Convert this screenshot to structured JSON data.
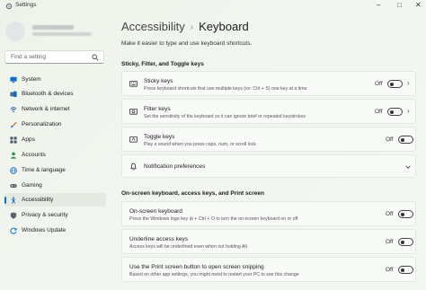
{
  "window": {
    "title": "Settings"
  },
  "sidebar": {
    "search_placeholder": "Find a setting",
    "items": [
      {
        "label": "System",
        "icon": "monitor-icon",
        "color": "#0a6ed1",
        "active": false
      },
      {
        "label": "Bluetooth & devices",
        "icon": "bluetooth-icon",
        "color": "#0a6ed1",
        "active": false
      },
      {
        "label": "Network & internet",
        "icon": "network-icon",
        "color": "#1e5aa8",
        "active": false
      },
      {
        "label": "Personalization",
        "icon": "brush-icon",
        "color": "#c96a2a",
        "active": false
      },
      {
        "label": "Apps",
        "icon": "apps-icon",
        "color": "#4a5b6c",
        "active": false
      },
      {
        "label": "Accounts",
        "icon": "account-icon",
        "color": "#2c8c4a",
        "active": false
      },
      {
        "label": "Time & language",
        "icon": "globe-clock-icon",
        "color": "#1670c9",
        "active": false
      },
      {
        "label": "Gaming",
        "icon": "gamepad-icon",
        "color": "#555f66",
        "active": false
      },
      {
        "label": "Accessibility",
        "icon": "accessibility-icon",
        "color": "#1670c9",
        "active": true
      },
      {
        "label": "Privacy & security",
        "icon": "shield-icon",
        "color": "#5a6570",
        "active": false
      },
      {
        "label": "Windows Update",
        "icon": "update-icon",
        "color": "#1670c9",
        "active": false
      }
    ]
  },
  "header": {
    "breadcrumb_parent": "Accessibility",
    "breadcrumb_sep": "›",
    "breadcrumb_current": "Keyboard",
    "subtitle": "Make it easier to type and use keyboard shortcuts."
  },
  "sections": {
    "sticky_heading": "Sticky, Filter, and Toggle keys",
    "onscreen_heading": "On-screen keyboard, access keys, and Print screen"
  },
  "settings": {
    "sticky": {
      "title": "Sticky keys",
      "desc": "Press keyboard shortcuts that use multiple keys (ex: Ctrl + S) one key at a time",
      "state": "Off"
    },
    "filter": {
      "title": "Filter keys",
      "desc": "Set the sensitivity of the keyboard so it can ignore brief or repeated keystrokes",
      "state": "Off"
    },
    "toggle": {
      "title": "Toggle keys",
      "desc": "Play a sound when you press caps, num, or scroll lock",
      "state": "Off"
    },
    "notifications": {
      "title": "Notification preferences"
    },
    "onscreen": {
      "title": "On-screen keyboard",
      "desc": "Press the Windows logo key ⊞ + Ctrl + O to turn the on-screen keyboard on or off",
      "state": "Off"
    },
    "underline": {
      "title": "Underline access keys",
      "desc": "Access keys will be underlined even when not holding Alt",
      "state": "Off"
    },
    "printscreen": {
      "title": "Use the Print screen button to open screen snipping",
      "desc": "Based on other app settings, you might need to restart your PC to see this change",
      "state": "Off"
    }
  },
  "colors": {
    "accent": "#0a6ed1"
  }
}
